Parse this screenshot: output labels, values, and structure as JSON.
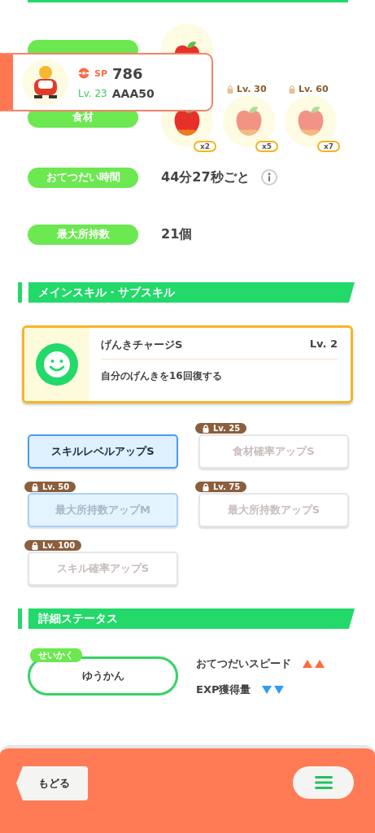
{
  "profile_card": {
    "sp_label": "SP",
    "sp": "786",
    "level": "Lv. 23",
    "name": "AAA50"
  },
  "stats": [
    {
      "kind": "berry"
    },
    {
      "kind": "ingredients",
      "label": "食材",
      "items": [
        {
          "count": "x2",
          "locked": false
        },
        {
          "count": "x5",
          "locked": true,
          "unlock": "Lv. 30"
        },
        {
          "count": "x7",
          "locked": true,
          "unlock": "Lv. 60"
        }
      ]
    },
    {
      "kind": "text",
      "label": "おてつだい時間",
      "value": "44分27秒ごと",
      "info": true
    },
    {
      "kind": "text",
      "label": "最大所持数",
      "value": "21個",
      "info": false
    }
  ],
  "skills_section": {
    "title": "メインスキル・サブスキル"
  },
  "main_skill": {
    "name": "げんきチャージS",
    "level": "Lv. 2",
    "description": "自分のげんきを16回復する"
  },
  "sub_skill_rows": [
    [
      {
        "label": "スキルレベルアップS",
        "tinted": true,
        "locked": false,
        "selected": true
      },
      {
        "label": "食材確率アップS",
        "tinted": false,
        "locked": true,
        "unlock": "Lv. 25",
        "selected": false
      }
    ],
    [
      {
        "label": "最大所持数アップM",
        "tinted": true,
        "locked": true,
        "unlock": "Lv. 50",
        "selected": false
      },
      {
        "label": "最大所持数アップS",
        "tinted": false,
        "locked": true,
        "unlock": "Lv. 75",
        "selected": false
      }
    ],
    [
      {
        "label": "スキル確率アップS",
        "tinted": false,
        "locked": true,
        "unlock": "Lv. 100",
        "selected": false
      }
    ]
  ],
  "details_section": {
    "title": "詳細ステータス"
  },
  "nature": {
    "tag": "せいかく",
    "value": "ゆうかん",
    "effects": [
      {
        "label": "おてつだいスピード",
        "up": true
      },
      {
        "label": "EXP獲得量",
        "up": false
      }
    ]
  },
  "footer": {
    "back": "もどる"
  }
}
